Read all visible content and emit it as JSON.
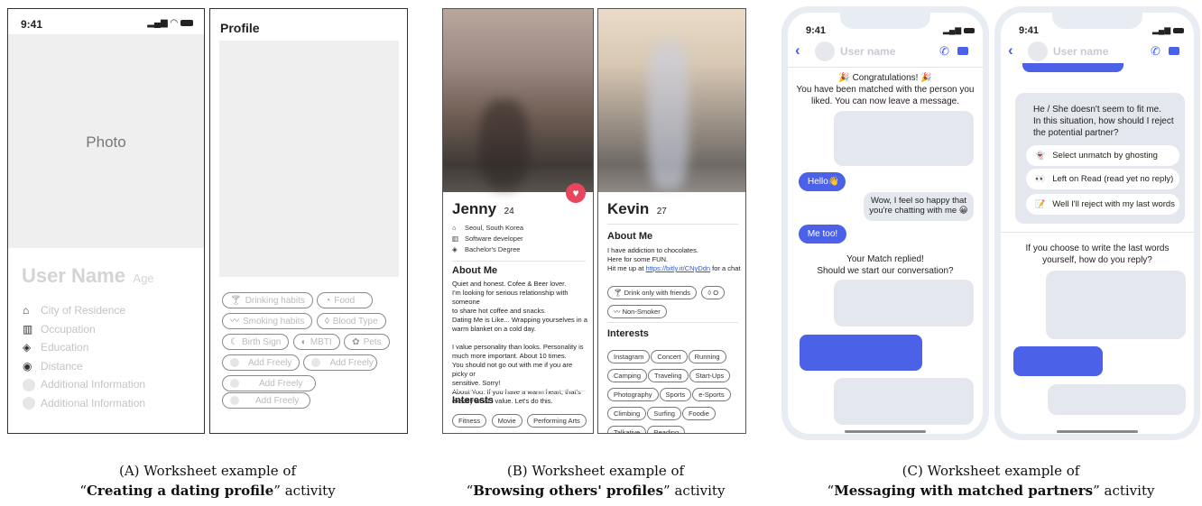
{
  "a": {
    "statusTime": "9:41",
    "photoLabel": "Photo",
    "userName": "User Name",
    "age": "Age",
    "infoRows": [
      "City of Residence",
      "Occupation",
      "Education",
      "Distance",
      "Additional Information",
      "Additional Information"
    ],
    "profileTitle": "Profile",
    "pills": [
      "Drinking habits",
      "Food",
      "Smoking habits",
      "Blood Type",
      "Birth Sign",
      "MBTI",
      "Pets",
      "Add Freely",
      "Add Freely",
      "Add Freely",
      "Add Freely"
    ]
  },
  "b": {
    "jenny": {
      "name": "Jenny",
      "age": "24",
      "info": [
        "Seoul, South Korea",
        "Software developer",
        "Bachelor's Degree"
      ],
      "aboutTitle": "About Me",
      "aboutLines": [
        "Quiet and honest. Cofee & Beer lover.",
        "I'm looking for serious relationship with someone",
        "to share hot coffee and snacks.",
        "Dating Me is Like... Wrapping yourselves in a",
        "warm blanket on a cold day.",
        "",
        "I value personality than looks. Personality is",
        "much more important. About 10 times.",
        "You should not go out with me if you are picky or",
        "sensitive. Sorry!",
        "About You: If you have a warm heart, that's",
        "exactly what I value. Let's do this."
      ],
      "interestsTitle": "Interests",
      "interests": [
        "Fitness",
        "Movie",
        "Performing Arts"
      ]
    },
    "kevin": {
      "name": "Kevin",
      "age": "27",
      "aboutTitle": "About Me",
      "aboutLines": [
        "I have addiction to chocolates.",
        "Here for some FUN."
      ],
      "linkPrefix": "Hit me up at ",
      "link": "https://bitly.it/CNyDdn",
      "linkSuffix": " for a chat",
      "tags": [
        "Drink only with friends",
        "O",
        "Non-Smoker"
      ],
      "interestsTitle": "Interests",
      "interests": [
        "Instagram",
        "Concert",
        "Running",
        "Camping",
        "Traveling",
        "Start-Ups",
        "Photography",
        "Sports",
        "e-Sports",
        "Climbing",
        "Surfing",
        "Foodie",
        "Talkative",
        "Reading"
      ]
    }
  },
  "c": {
    "time": "9:41",
    "userName": "User name",
    "congrats": "🎉 Congratulations! 🎉",
    "matchLines": [
      "You have been matched with the person you",
      "liked. You can now leave a message."
    ],
    "hello": "Hello👋",
    "wowLines": [
      "Wow, I feel so happy that",
      "you're chatting with me 😀"
    ],
    "meToo": "Me too!",
    "repliedLines": [
      "Your Match replied!",
      "Should we start our conversation?"
    ],
    "rejectLines": [
      "He / She doesn't seem to fit me.",
      "In this situation, how should I reject",
      "the potential partner?"
    ],
    "options": [
      "Select unmatch by ghosting",
      "Left on Read (read yet no reply)",
      "Well I'll reject with my last words"
    ],
    "optionIcons": [
      "👻",
      "👀",
      "📝"
    ],
    "lastLines": [
      "If you choose to write the last words",
      "yourself, how do you reply?"
    ]
  },
  "captions": {
    "a1": "(A) Worksheet example of",
    "a2": "Creating a dating profile",
    "a3": " activity",
    "b1": "(B) Worksheet example of",
    "b2": "Browsing others' profiles",
    "b3": " activity",
    "c1": "(C) Worksheet example of",
    "c2": "Messaging with matched partners",
    "c3": " activity"
  },
  "colors": {
    "accent": "#4a61e8",
    "heart": "#e8465f",
    "bubble": "#e4e7ee",
    "phone": "#e8ecf3"
  }
}
